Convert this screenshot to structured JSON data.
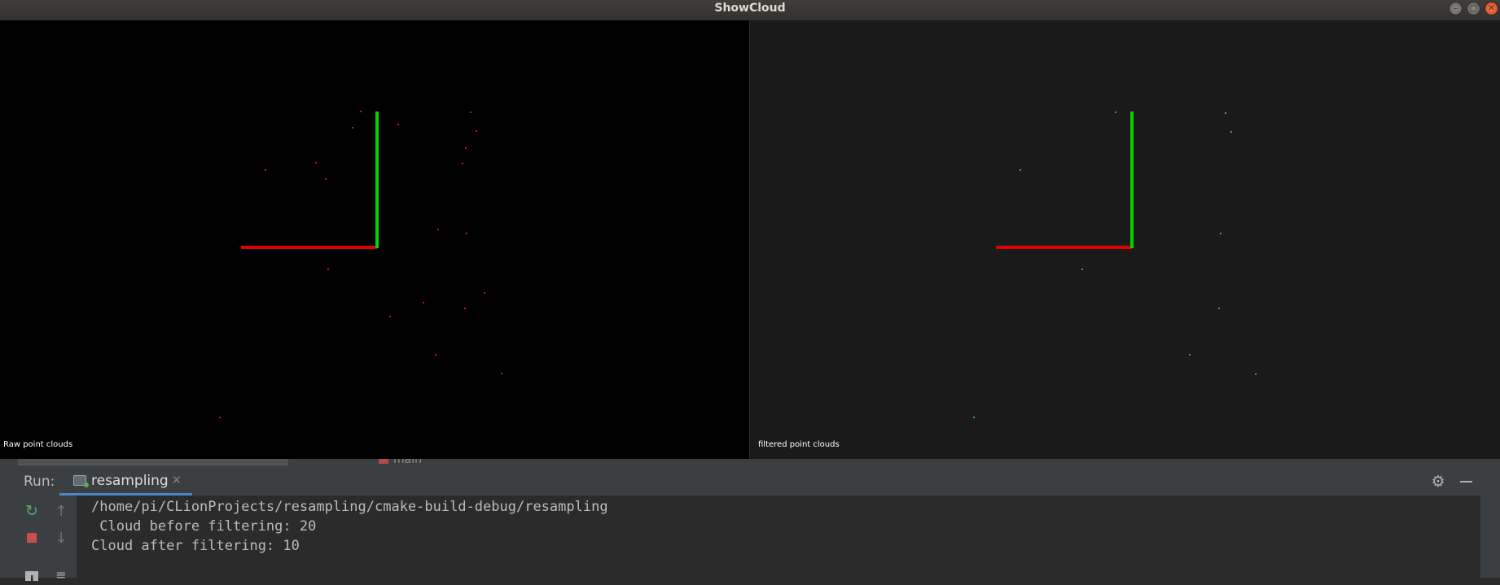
{
  "window": {
    "title": "ShowCloud",
    "controls": {
      "minimize": "–",
      "maximize": "□",
      "close": "✕"
    }
  },
  "viewports": {
    "left": {
      "caption": "Raw point clouds",
      "background": "#000000",
      "point_color": "#c41616",
      "point_count": 20
    },
    "right": {
      "caption": "filtered point clouds",
      "background": "#1a1a1a",
      "point_color": "#2eb82e",
      "point_count": 10
    },
    "axis_colors": {
      "x": "#e00000",
      "y": "#00d400"
    }
  },
  "ide": {
    "behind_tab": "main",
    "run_label": "Run:",
    "run_tab": {
      "label": "resampling",
      "close": "×"
    },
    "icons": {
      "settings": "gear-icon",
      "minimize": "minimize-icon",
      "rerun": "rerun-icon",
      "stop": "stop-icon",
      "up": "arrow-up-icon",
      "down": "arrow-down-icon",
      "wrap": "soft-wrap-icon",
      "layout": "layout-icon"
    },
    "console": {
      "lines": [
        "/home/pi/CLionProjects/resampling/cmake-build-debug/resampling",
        " Cloud before filtering: 20",
        "Cloud after filtering: 10"
      ]
    }
  }
}
